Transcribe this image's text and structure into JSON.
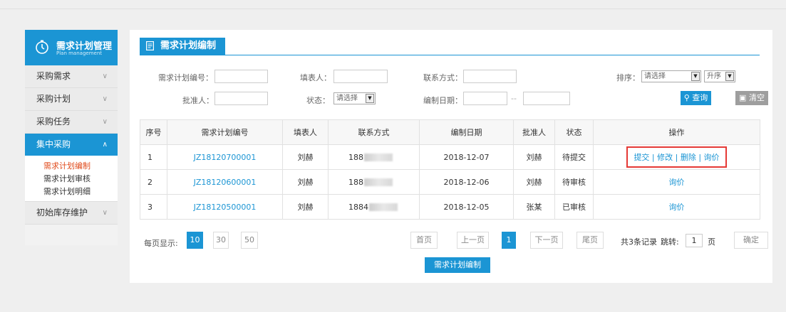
{
  "sidebar": {
    "title": "需求计划管理",
    "subtitle": "Plan management",
    "items": [
      {
        "label": "采购需求",
        "chevron": "∨"
      },
      {
        "label": "采购计划",
        "chevron": "∨"
      },
      {
        "label": "采购任务",
        "chevron": "∨"
      },
      {
        "label": "集中采购",
        "chevron": "∧"
      }
    ],
    "subitems": [
      "需求计划编制",
      "需求计划审核",
      "需求计划明细"
    ],
    "last_item": {
      "label": "初始库存维护",
      "chevron": "∨"
    }
  },
  "page": {
    "title": "需求计划编制"
  },
  "filters": {
    "plan_no_label": "需求计划编号：",
    "filler_label": "填表人：",
    "contact_label": "联系方式：",
    "sort_label": "排序：",
    "sort_value": "请选择",
    "order_value": "升序",
    "approver_label": "批准人：",
    "status_label": "状态：",
    "status_value": "请选择",
    "date_label": "编制日期：",
    "date_sep": "--",
    "search_label": "查询",
    "clear_label": "清空"
  },
  "table": {
    "headers": [
      "序号",
      "需求计划编号",
      "填表人",
      "联系方式",
      "编制日期",
      "批准人",
      "状态",
      "操作"
    ],
    "rows": [
      {
        "no": "1",
        "code": "JZ18120700001",
        "filler": "刘赫",
        "contact": "188",
        "date": "2018-12-07",
        "approver": "刘赫",
        "status": "待提交",
        "ops": "提交 | 修改 | 删除 | 询价"
      },
      {
        "no": "2",
        "code": "JZ18120600001",
        "filler": "刘赫",
        "contact": "188",
        "date": "2018-12-06",
        "approver": "刘赫",
        "status": "待审核",
        "ops": "询价"
      },
      {
        "no": "3",
        "code": "JZ18120500001",
        "filler": "刘赫",
        "contact": "1884",
        "date": "2018-12-05",
        "approver": "张某",
        "status": "已审核",
        "ops": "询价"
      }
    ]
  },
  "pagination": {
    "per_page_label": "每页显示:",
    "sizes": [
      "10",
      "30",
      "50"
    ],
    "first": "首页",
    "prev": "上一页",
    "current": "1",
    "next": "下一页",
    "last": "尾页",
    "total": "共3条记录",
    "jump_label": "跳转:",
    "jump_value": "1",
    "page_unit": "页",
    "confirm": "确定"
  },
  "bottom_button": "需求计划编制",
  "colors": {
    "accent": "#1b95d4",
    "active_sub": "#e04b1c",
    "highlight_box": "#e53935"
  }
}
